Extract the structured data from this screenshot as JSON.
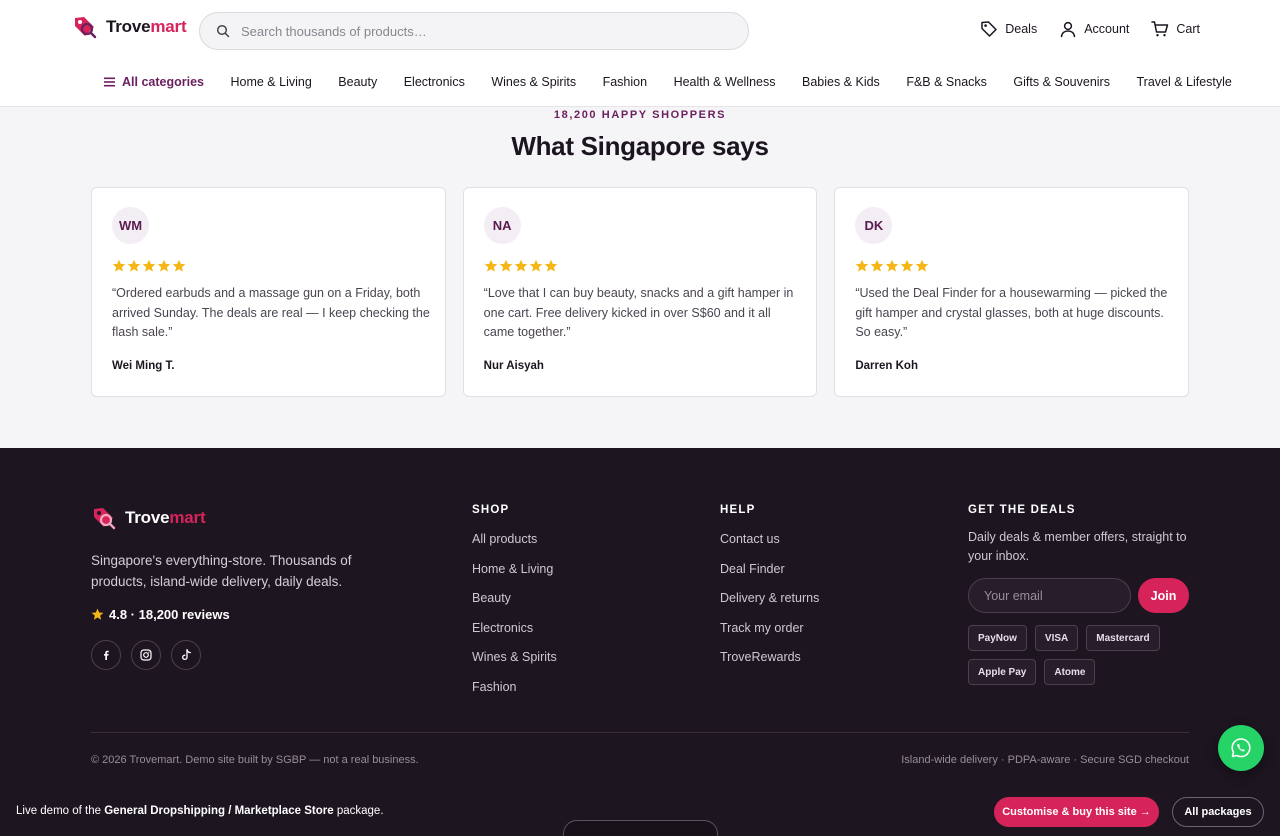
{
  "brand": {
    "name_part1": "Trove",
    "name_part2": "mart",
    "accent_color": "#d6245a",
    "icon": "price-tag-search-icon"
  },
  "search": {
    "placeholder": "Search thousands of products…",
    "icon": "search-icon"
  },
  "top_actions": [
    {
      "label": "Deals",
      "icon": "tag-icon"
    },
    {
      "label": "Account",
      "icon": "user-icon"
    },
    {
      "label": "Cart",
      "icon": "cart-icon"
    }
  ],
  "categories": {
    "all_label": "All categories",
    "items": [
      "Home & Living",
      "Beauty",
      "Electronics",
      "Wines & Spirits",
      "Fashion",
      "Health & Wellness",
      "Babies & Kids",
      "F&B & Snacks",
      "Gifts & Souvenirs",
      "Travel & Lifestyle"
    ]
  },
  "reviews": {
    "eyebrow": "18,200 HAPPY SHOPPERS",
    "title": "What Singapore says",
    "items": [
      {
        "initials": "WM",
        "stars": 5,
        "quote": "“Ordered earbuds and a massage gun on a Friday, both arrived Sunday. The deals are real — I keep checking the flash sale.”",
        "author": "Wei Ming T."
      },
      {
        "initials": "NA",
        "stars": 5,
        "quote": "“Love that I can buy beauty, snacks and a gift hamper in one cart. Free delivery kicked in over S$60 and it all came together.”",
        "author": "Nur Aisyah"
      },
      {
        "initials": "DK",
        "stars": 5,
        "quote": "“Used the Deal Finder for a housewarming — picked the gift hamper and crystal glasses, both at huge discounts. So easy.”",
        "author": "Darren Koh"
      }
    ]
  },
  "footer": {
    "description": "Singapore's everything-store. Thousands of products, island-wide delivery, daily deals.",
    "rating": "4.8 · 18,200 reviews",
    "socials": [
      "facebook-icon",
      "instagram-icon",
      "tiktok-icon"
    ],
    "shop": {
      "title": "SHOP",
      "links": [
        "All products",
        "Home & Living",
        "Beauty",
        "Electronics",
        "Wines & Spirits",
        "Fashion"
      ]
    },
    "help": {
      "title": "HELP",
      "links": [
        "Contact us",
        "Deal Finder",
        "Delivery & returns",
        "Track my order",
        "TroveRewards"
      ]
    },
    "deals": {
      "title": "GET THE DEALS",
      "description": "Daily deals & member offers, straight to your inbox.",
      "email_placeholder": "Your email",
      "join_label": "Join",
      "payments": [
        "PayNow",
        "VISA",
        "Mastercard",
        "Apple Pay",
        "Atome"
      ]
    },
    "copyright": "© 2026 Trovemart. Demo site built by SGBP — not a real business.",
    "right_text": "Island-wide delivery · PDPA-aware · Secure SGD checkout"
  },
  "demo_bar": {
    "prefix": "Live demo of the ",
    "package": "General Dropshipping / Marketplace Store",
    "suffix": " package.",
    "customise_label": "Customise & buy this site →",
    "packages_label": "All packages"
  },
  "whatsapp": {
    "icon": "whatsapp-icon",
    "color": "#25d366"
  }
}
